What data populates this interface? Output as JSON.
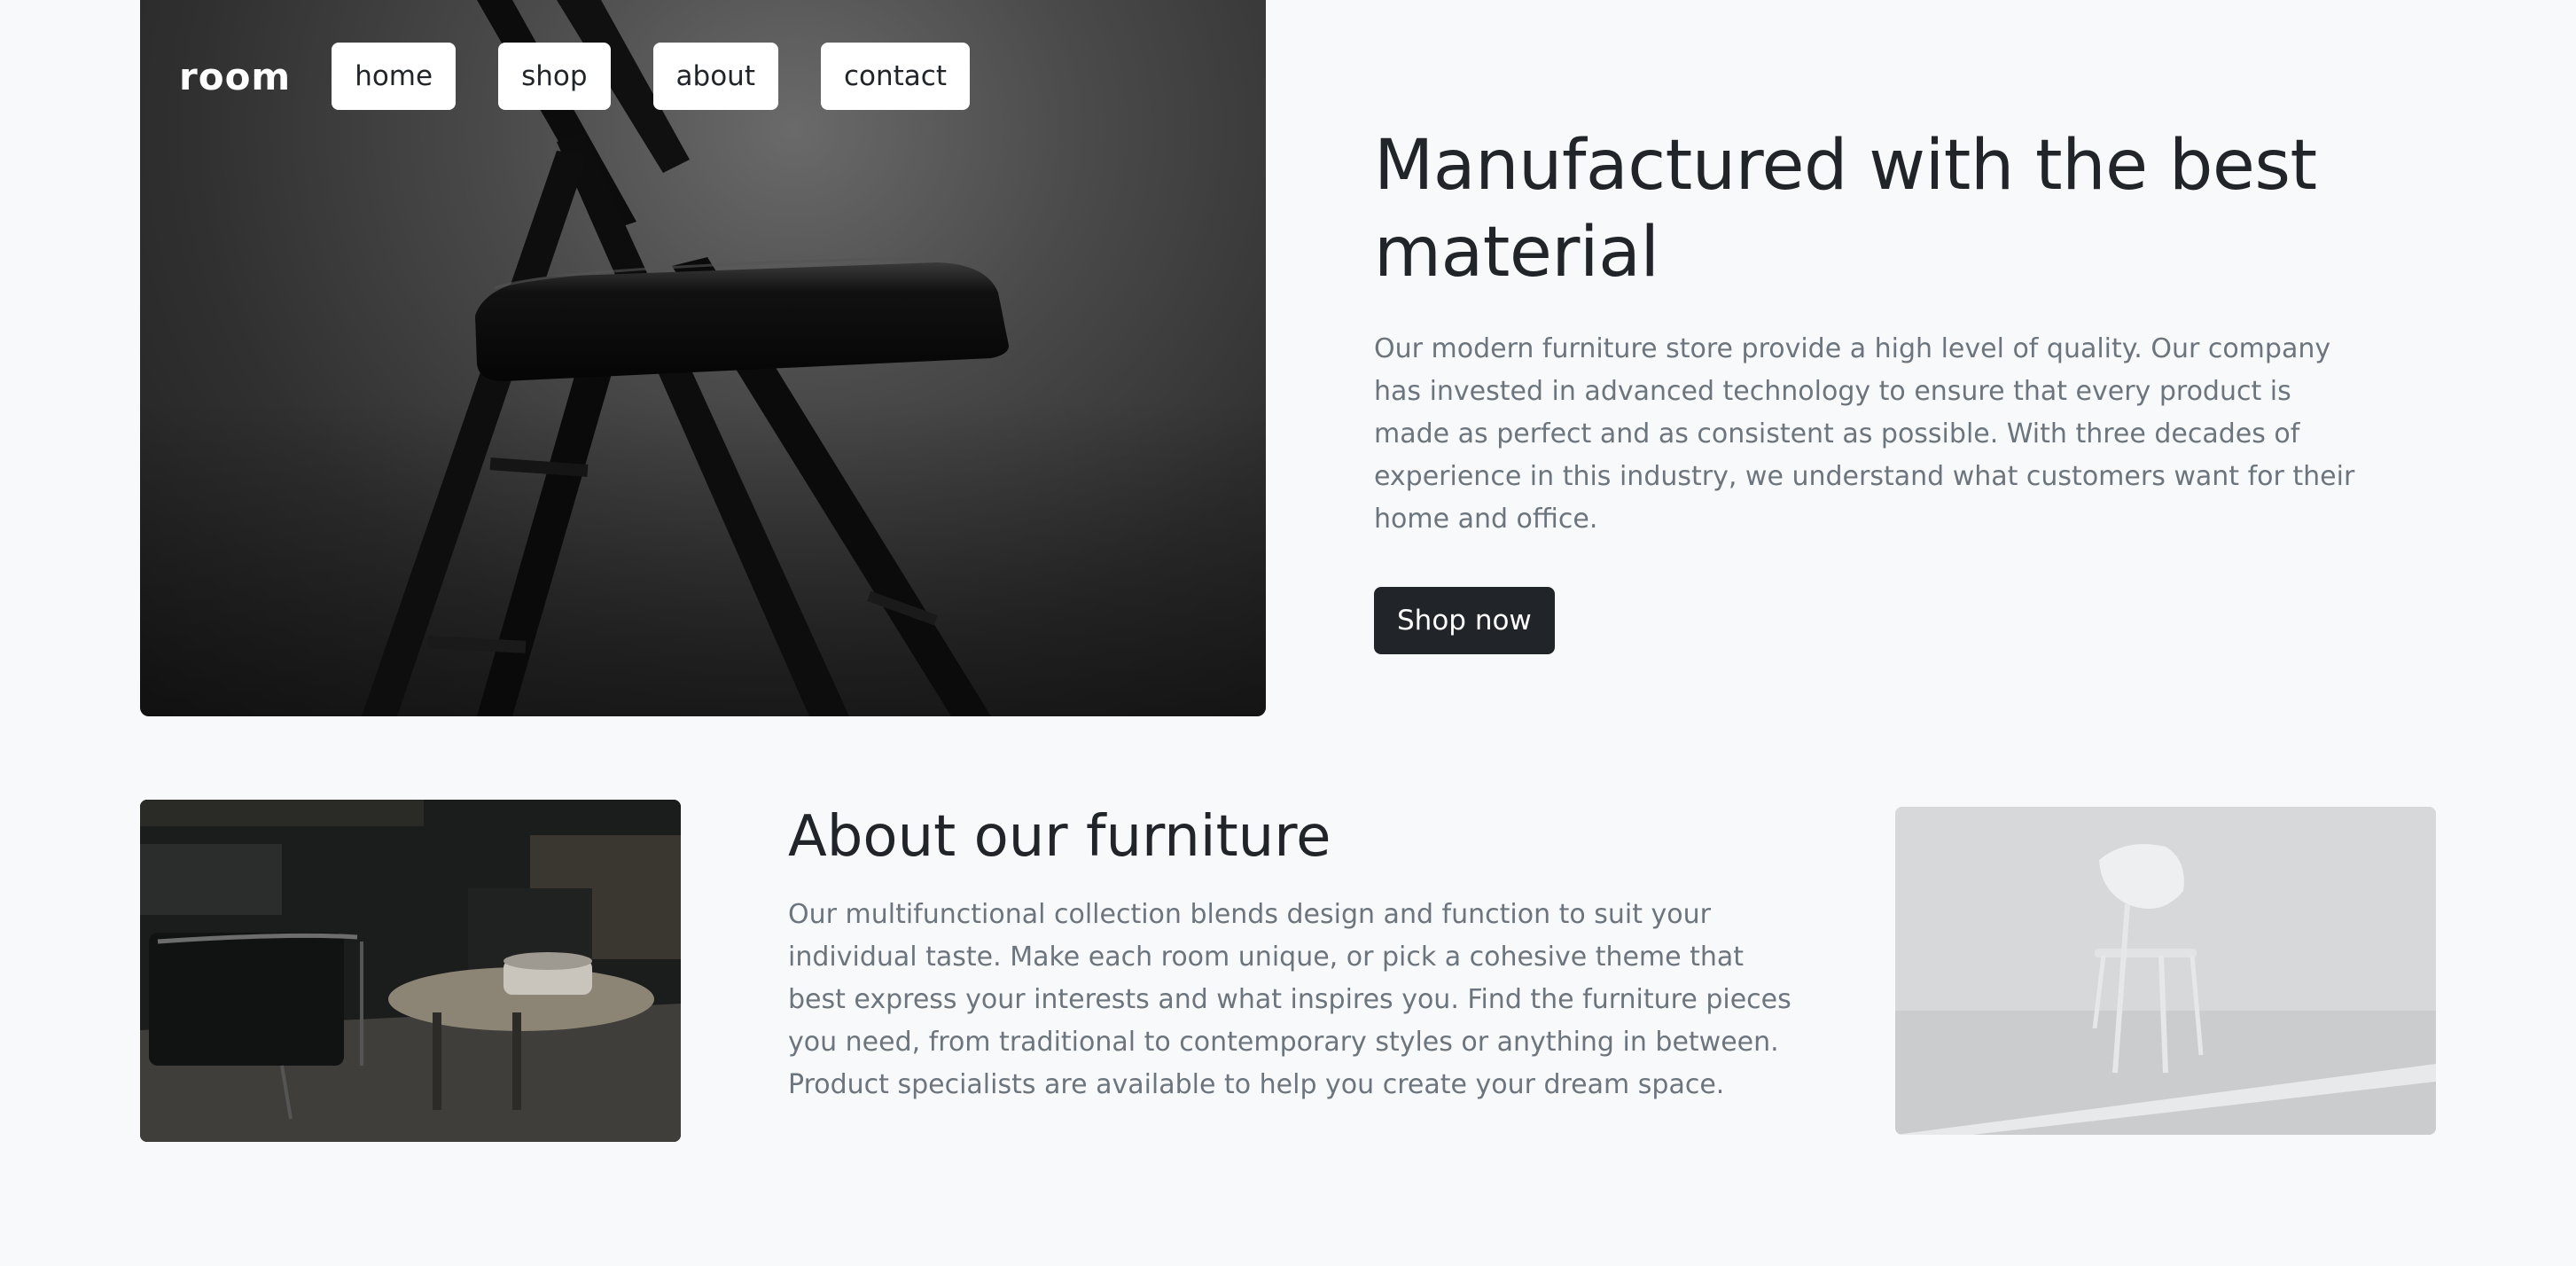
{
  "brand": {
    "logo_text": "room"
  },
  "nav": {
    "items": [
      {
        "label": "home"
      },
      {
        "label": "shop"
      },
      {
        "label": "about"
      },
      {
        "label": "contact"
      }
    ]
  },
  "hero": {
    "title": "Manufactured with the best material",
    "description": "Our modern furniture store provide a high level of quality. Our company has invested in advanced technology to ensure that every product is made as perfect and as consistent as possible. With three decades of experience in this industry, we understand what customers want for their home and office.",
    "cta_label": "Shop now"
  },
  "about": {
    "title": "About our furniture",
    "description": "Our multifunctional collection blends design and function to suit your individual taste. Make each room unique, or pick a cohesive theme that best express your interests and what inspires you. Find the furniture pieces you need, from traditional to contemporary styles or anything in between. Product specialists are available to help you create your dream space."
  },
  "colors": {
    "background": "#f8f9fa",
    "heading": "#212529",
    "body_text": "#6c757d",
    "button_dark": "#212529",
    "nav_button_bg": "#ffffff"
  }
}
